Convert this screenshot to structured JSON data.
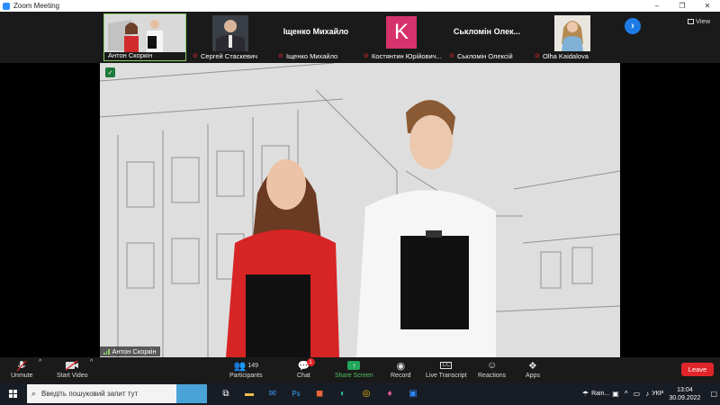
{
  "window": {
    "title": "Zoom Meeting"
  },
  "window_controls": {
    "minimize": "–",
    "restore": "❐",
    "close": "✕"
  },
  "gallery": {
    "view_label": "View",
    "next_icon": "›",
    "thumbnails": [
      {
        "name": "Антон Скоркін",
        "muted": false,
        "type": "video",
        "active": true
      },
      {
        "name": "Сергей Стаскевич",
        "muted": true,
        "type": "video"
      },
      {
        "name": "Іщенко Михайло",
        "muted": true,
        "type": "name",
        "display": "Іщенко Михайло"
      },
      {
        "name": "Костянтин Юрійович...",
        "muted": true,
        "type": "avatar",
        "initial": "K"
      },
      {
        "name": "Ськломін Олексій",
        "muted": true,
        "type": "name",
        "display": "Ськломін Олек..."
      },
      {
        "name": "Olha Kaidalova",
        "muted": true,
        "type": "video"
      }
    ]
  },
  "main": {
    "speaker": "Антон Скоркін",
    "shield_icon": "✓"
  },
  "toolbar": {
    "unmute": "Unmute",
    "start_video": "Start Video",
    "participants": "Participants",
    "participants_count": "149",
    "chat": "Chat",
    "chat_badge": "1",
    "share_screen": "Share Screen",
    "record": "Record",
    "live_transcript": "Live Transcript",
    "cc_icon": "CC",
    "reactions": "Reactions",
    "apps": "Apps",
    "leave": "Leave"
  },
  "taskbar": {
    "search_placeholder": "Введіть пошуковий запит тут",
    "weather": "Rain...",
    "language": "УКР",
    "time": "13:04",
    "date": "30.09.2022"
  },
  "colors": {
    "accent": "#2d8cff",
    "leave": "#e0262b",
    "share": "#23a55a",
    "active_border": "#8bd066"
  }
}
